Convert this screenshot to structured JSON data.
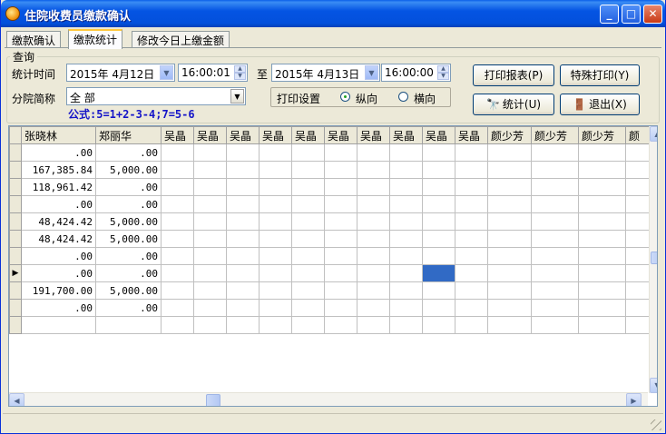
{
  "window": {
    "title": "住院收费员缴款确认"
  },
  "tabs": [
    {
      "label": "缴款确认",
      "active": false
    },
    {
      "label": "缴款统计",
      "active": true
    },
    {
      "label": "修改今日上缴金额",
      "active": false
    }
  ],
  "query": {
    "group_label": "查询",
    "time_label": "统计时间",
    "start_date": "2015年  4月12日",
    "start_time": "16:00:01",
    "to_label": "至",
    "end_date": "2015年  4月13日",
    "end_time": "16:00:00",
    "branch_label": "分院简称",
    "branch_value": "全 部",
    "formula": "公式:5=1+2-3-4;7=5-6",
    "print_settings_label": "打印设置",
    "orientation": [
      {
        "label": "纵向",
        "selected": true
      },
      {
        "label": "横向",
        "selected": false
      }
    ]
  },
  "buttons": {
    "print_report": "打印报表(P)",
    "special_print": "特殊打印(Y)",
    "stats": "统计(U)",
    "exit": "退出(X)"
  },
  "grid": {
    "columns": [
      "张晓林",
      "郑丽华",
      "吴晶",
      "吴晶",
      "吴晶",
      "吴晶",
      "吴晶",
      "吴晶",
      "吴晶",
      "吴晶",
      "吴晶",
      "吴晶",
      "颜少芳",
      "颜少芳",
      "颜少芳",
      "颜"
    ],
    "rows": [
      [
        ".00",
        ".00"
      ],
      [
        "167,385.84",
        "5,000.00"
      ],
      [
        "118,961.42",
        ".00"
      ],
      [
        ".00",
        ".00"
      ],
      [
        "48,424.42",
        "5,000.00"
      ],
      [
        "48,424.42",
        "5,000.00"
      ],
      [
        ".00",
        ".00"
      ],
      [
        ".00",
        ".00"
      ],
      [
        "191,700.00",
        "5,000.00"
      ],
      [
        ".00",
        ".00"
      ]
    ],
    "current_row": 7,
    "selected_cell": {
      "row": 7,
      "col": 10
    }
  },
  "colors": {
    "titlebar": "#0454e3",
    "selection": "#316ac5",
    "formula": "#1414c8"
  },
  "icons": {
    "app": "app-icon",
    "stats": "binoculars-icon",
    "exit": "exit-door-icon"
  }
}
